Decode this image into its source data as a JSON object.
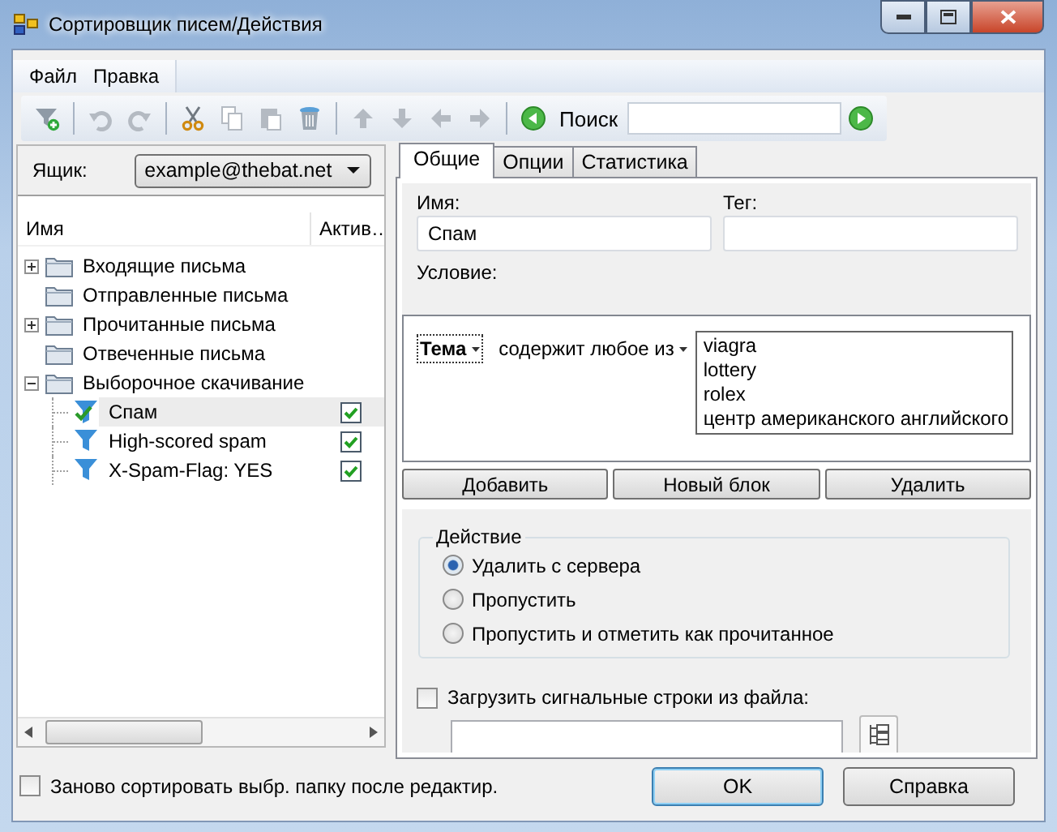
{
  "window": {
    "title": "Сортировщик писем/Действия"
  },
  "menu": [
    {
      "label": "Файл"
    },
    {
      "label": "Правка"
    }
  ],
  "toolbar": {
    "groups": [
      [
        {
          "kind": "filter-add",
          "disabled": false
        }
      ],
      [
        {
          "kind": "undo",
          "disabled": true
        },
        {
          "kind": "redo",
          "disabled": true
        }
      ],
      [
        {
          "kind": "cut",
          "disabled": false
        },
        {
          "kind": "copy",
          "disabled": true
        },
        {
          "kind": "paste",
          "disabled": true
        },
        {
          "kind": "delete",
          "disabled": false
        }
      ],
      [
        {
          "kind": "up",
          "disabled": true
        },
        {
          "kind": "down",
          "disabled": true
        },
        {
          "kind": "left",
          "disabled": true
        },
        {
          "kind": "right",
          "disabled": true
        }
      ],
      [
        {
          "kind": "back",
          "disabled": false
        },
        {
          "kind": "search",
          "label": "Поиск"
        },
        {
          "kind": "forward",
          "disabled": false
        }
      ]
    ]
  },
  "mailbox": {
    "label": "Ящик:",
    "value": "example@thebat.net"
  },
  "tree": {
    "columns": [
      "Имя",
      "Актив…"
    ],
    "items": [
      {
        "label": "Входящие письма",
        "kind": "folder",
        "expanded": false
      },
      {
        "label": "Отправленные письма",
        "kind": "folder"
      },
      {
        "label": "Прочитанные письма",
        "kind": "folder",
        "expanded": false
      },
      {
        "label": "Отвеченные письма",
        "kind": "folder"
      },
      {
        "label": "Выборочное скачивание",
        "kind": "folder",
        "expanded": true,
        "children": [
          {
            "label": "Спам",
            "kind": "filter",
            "selected": true,
            "checked": true
          },
          {
            "label": "High-scored spam",
            "kind": "filter",
            "selected": false,
            "checked": true
          },
          {
            "label": "X-Spam-Flag: YES",
            "kind": "filter",
            "selected": false,
            "checked": true
          }
        ]
      }
    ]
  },
  "tabs": [
    {
      "label": "Общие",
      "selected": true
    },
    {
      "label": "Опции",
      "selected": false
    },
    {
      "label": "Статистика",
      "selected": false
    }
  ],
  "name_field": {
    "label": "Имя:",
    "value": "Спам"
  },
  "tag_field": {
    "label": "Тег:"
  },
  "condition": {
    "label": "Условие:",
    "field": "Тема",
    "operator": "содержит любое из",
    "values": [
      "viagra",
      "lottery",
      "rolex",
      "центр американского английского"
    ]
  },
  "condition_buttons": [
    "Добавить",
    "Новый блок",
    "Удалить"
  ],
  "action": {
    "title": "Действие",
    "options": [
      {
        "label": "Удалить с сервера",
        "selected": true
      },
      {
        "label": "Пропустить",
        "selected": false
      },
      {
        "label": "Пропустить и отметить как прочитанное",
        "selected": false
      }
    ]
  },
  "load_file": {
    "label": "Загрузить сигнальные строки из файла:",
    "checked": false
  },
  "footer": {
    "resort": {
      "label": "Заново сортировать выбр. папку после редактир.",
      "checked": false
    },
    "buttons": [
      {
        "label": "OK",
        "default": true
      },
      {
        "label": "Справка",
        "default": false
      }
    ]
  }
}
